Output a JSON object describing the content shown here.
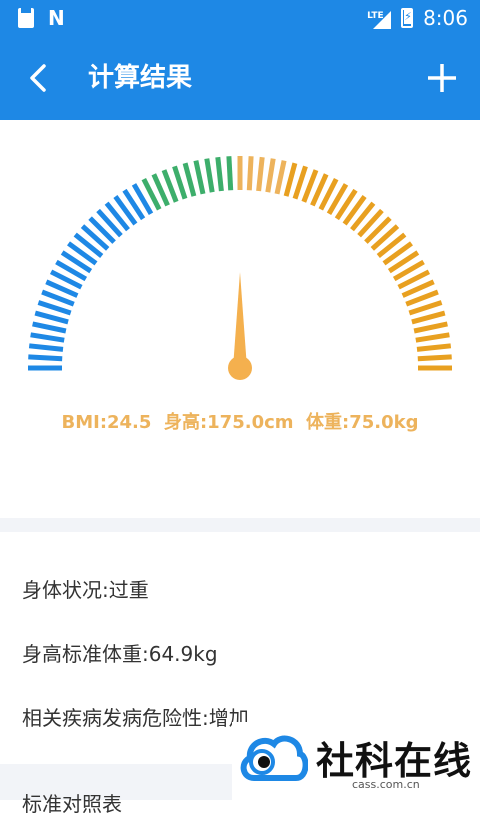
{
  "status_bar": {
    "time": "8:06",
    "network": "LTE"
  },
  "toolbar": {
    "title": "计算结果"
  },
  "gauge": {
    "value_fraction": 0.5,
    "color_blue": "#1E88E5",
    "color_green": "#3DAE6B",
    "color_light_orange": "#EDB35C",
    "color_orange": "#E8A020",
    "needle_color": "#F4B04E"
  },
  "summary": {
    "text": "BMI:24.5  身高:175.0cm  体重:75.0kg"
  },
  "info": {
    "condition": "身体状况:过重",
    "standard_weight": "身高标准体重:64.9kg",
    "risk": "相关疾病发病危险性:增加"
  },
  "bottom": {
    "label": "标准对照表"
  },
  "watermark": {
    "brand": "社科在线",
    "url": "cass.com.cn"
  }
}
